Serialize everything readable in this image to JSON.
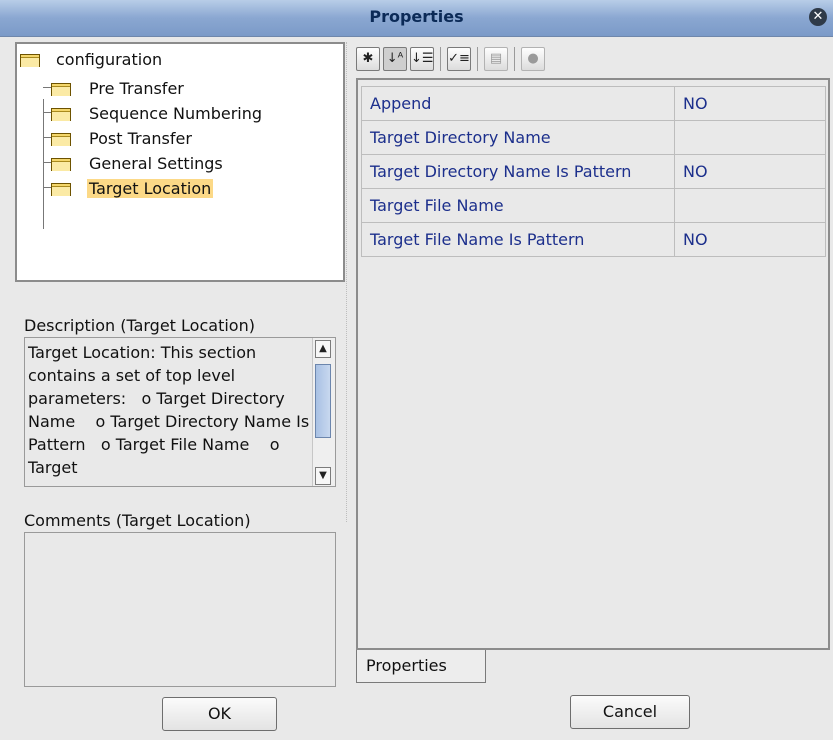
{
  "window": {
    "title": "Properties"
  },
  "tree": {
    "root": "configuration",
    "children": [
      "Pre Transfer",
      "Sequence Numbering",
      "Post Transfer",
      "General Settings",
      "Target Location"
    ],
    "selected": "Target Location"
  },
  "description": {
    "label": "Description (Target Location)",
    "text": "Target Location: This section contains a set of top level parameters:   o Target Directory Name    o Target Directory Name Is Pattern   o Target File Name    o Target"
  },
  "comments": {
    "label": "Comments (Target Location)",
    "text": ""
  },
  "toolbar": {
    "icons": [
      "asterisk-icon",
      "sort-az-icon",
      "sort-category-icon",
      "checklist-icon",
      "text-panel-icon",
      "help-icon"
    ]
  },
  "properties": {
    "rows": [
      {
        "name": "Append",
        "value": "NO"
      },
      {
        "name": "Target Directory Name",
        "value": ""
      },
      {
        "name": "Target Directory Name Is Pattern",
        "value": "NO"
      },
      {
        "name": "Target File Name",
        "value": ""
      },
      {
        "name": "Target File Name Is Pattern",
        "value": "NO"
      }
    ],
    "tab_label": "Properties"
  },
  "buttons": {
    "ok": "OK",
    "cancel": "Cancel"
  }
}
